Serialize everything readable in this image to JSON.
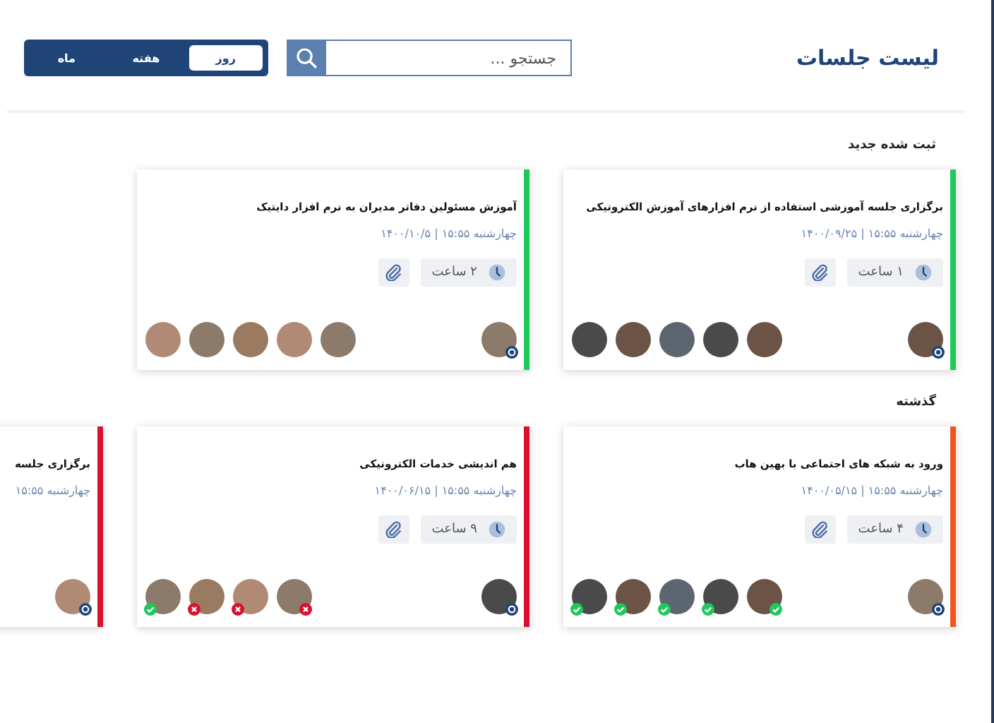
{
  "header": {
    "title": "لیست جلسات",
    "search": {
      "placeholder": "جستجو ..."
    },
    "views": [
      {
        "label": "روز",
        "selected": true
      },
      {
        "label": "هفته",
        "selected": false
      },
      {
        "label": "ماه",
        "selected": false
      }
    ]
  },
  "sections": [
    {
      "label": "ثبت شده جدید",
      "cards": [
        {
          "color": "#1fc959",
          "title": "برگزاری جلسه آموزشی استفاده از نرم افزارهای آموزش الکترونیکی",
          "date": "چهارشنبه ۱۵:۵۵ | ۱۴۰۰/۰۹/۲۵",
          "duration": "۱ ساعت",
          "attendees": [
            {
              "kind": "photo"
            },
            {
              "kind": "photo"
            },
            {
              "kind": "photo"
            },
            {
              "kind": "photo"
            },
            {
              "kind": "photo"
            }
          ]
        },
        {
          "color": "#1fc959",
          "title": "آموزش مسئولین دفاتر مدیران به نرم افزار دایتیک",
          "date": "چهارشنبه ۱۵:۵۵ | ۱۴۰۰/۱۰/۵",
          "duration": "۲ ساعت",
          "attendees": [
            {
              "kind": "photo"
            },
            {
              "kind": "photo"
            },
            {
              "kind": "photo"
            },
            {
              "kind": "photo"
            },
            {
              "kind": "photo"
            }
          ]
        }
      ]
    },
    {
      "label": "گذشته",
      "cards": [
        {
          "color": "#f0551f",
          "title": "ورود به شبکه های اجتماعی با بهین هاب",
          "date": "چهارشنبه ۱۵:۵۵ | ۱۴۰۰/۰۵/۱۵",
          "duration": "۴ ساعت",
          "attendees": [
            {
              "kind": "photo",
              "accepted": true
            },
            {
              "kind": "photo",
              "accepted": true
            },
            {
              "kind": "photo",
              "accepted": true
            },
            {
              "kind": "photo",
              "accepted": true
            },
            {
              "kind": "photo",
              "accepted": true
            }
          ]
        },
        {
          "color": "#d9102e",
          "title": "هم اندیشی خدمات الکترونیکی",
          "date": "چهارشنبه ۱۵:۵۵ | ۱۴۰۰/۰۶/۱۵",
          "duration": "۹ ساعت",
          "attendees": [
            {
              "kind": "photo",
              "accepted": false
            },
            {
              "kind": "photo",
              "accepted": false
            },
            {
              "kind": "photo",
              "accepted": false
            },
            {
              "kind": "photo",
              "accepted": true
            }
          ]
        },
        {
          "color": "#d9102e",
          "title": "برگزاری جلسه",
          "date": "چهارشنبه ۱۵:۵۵"
        }
      ]
    }
  ]
}
